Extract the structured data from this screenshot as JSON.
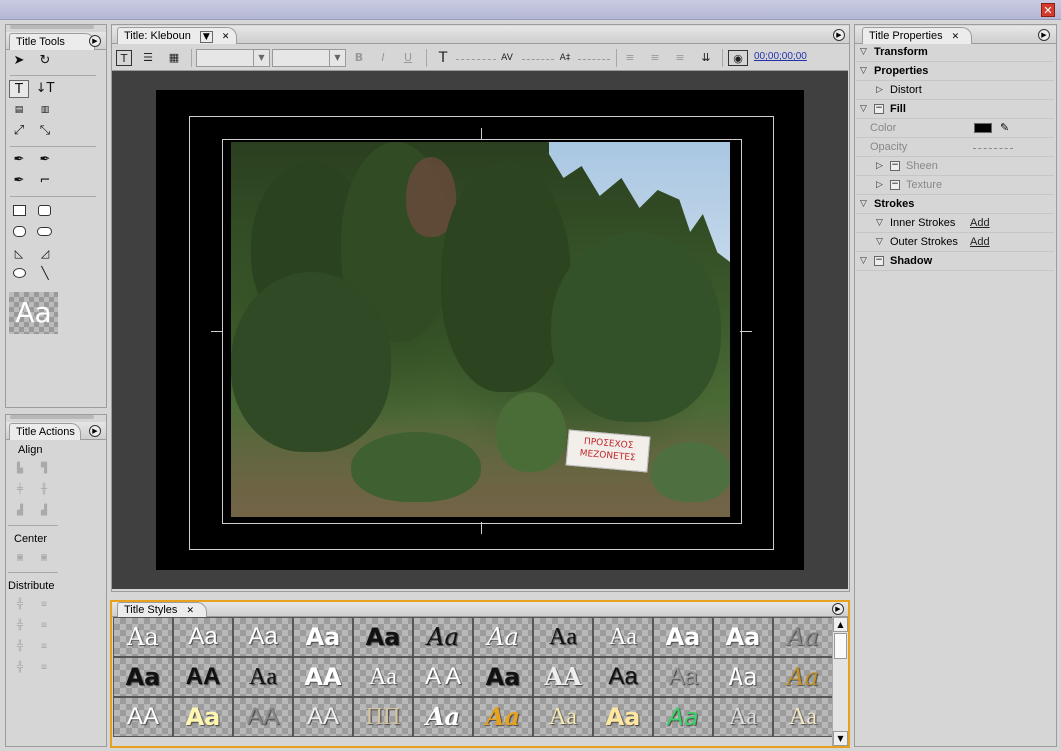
{
  "window": {
    "close_glyph": "✕"
  },
  "title_tools": {
    "tab_label": "Title Tools",
    "preview_text": "Aa"
  },
  "title_actions": {
    "tab_label": "Title Actions",
    "align_label": "Align",
    "center_label": "Center",
    "distribute_label": "Distribute"
  },
  "title_panel": {
    "tab_label": "Title: Kleboun",
    "timecode": "00;00;00;00",
    "font_family_value": "",
    "font_style_value": ""
  },
  "banner_text": [
    "ΠΡΟΣΕΧΟΣ",
    "ΜΕΖΟΝΕΤΕΣ"
  ],
  "title_styles": {
    "tab_label": "Title Styles",
    "swatches": [
      {
        "t": "Aa",
        "c": "#fff",
        "f": "\"DejaVu Serif\", serif",
        "w": "normal",
        "s": "italic-no"
      },
      {
        "t": "Aa",
        "c": "#fff",
        "f": "\"Liberation Sans\", sans-serif",
        "w": "normal"
      },
      {
        "t": "Aa",
        "c": "#fff",
        "f": "\"Liberation Sans\", sans-serif",
        "w": "normal"
      },
      {
        "t": "Aa",
        "c": "#fff",
        "f": "\"DejaVu Sans\", sans-serif",
        "w": "bold"
      },
      {
        "t": "Aa",
        "c": "#111",
        "f": "\"DejaVu Sans\", sans-serif",
        "w": "bold"
      },
      {
        "t": "Aa",
        "c": "#111",
        "f": "\"DejaVu Serif\", serif",
        "w": "normal",
        "i": true
      },
      {
        "t": "Aa",
        "c": "#fff",
        "f": "\"DejaVu Serif\", serif",
        "w": "normal",
        "i": true
      },
      {
        "t": "Aa",
        "c": "#111",
        "f": "\"Liberation Serif\", serif",
        "w": "normal"
      },
      {
        "t": "Aa",
        "c": "#fff",
        "f": "\"Liberation Serif\", serif",
        "w": "normal"
      },
      {
        "t": "Aa",
        "c": "#fff",
        "f": "\"DejaVu Sans\", sans-serif",
        "w": "bold"
      },
      {
        "t": "Aa",
        "c": "#fff",
        "f": "\"DejaVu Sans\", sans-serif",
        "w": "bold"
      },
      {
        "t": "Aa",
        "c": "#888",
        "f": "\"DejaVu Serif\", serif",
        "w": "normal",
        "i": true
      },
      {
        "t": "Aa",
        "c": "#111",
        "f": "\"DejaVu Sans\", sans-serif",
        "w": "bold"
      },
      {
        "t": "AA",
        "c": "#111",
        "f": "\"Liberation Sans\", sans-serif",
        "w": "bold"
      },
      {
        "t": "Aa",
        "c": "#111",
        "f": "\"Liberation Serif\", serif",
        "w": "normal"
      },
      {
        "t": "AA",
        "c": "#fff",
        "f": "\"DejaVu Sans\", sans-serif",
        "w": "bold"
      },
      {
        "t": "Aa",
        "c": "#fff",
        "f": "\"Liberation Serif\", serif",
        "w": "normal"
      },
      {
        "t": "A A",
        "c": "#fff",
        "f": "\"Liberation Sans\", sans-serif",
        "w": "normal"
      },
      {
        "t": "Aa",
        "c": "#111",
        "f": "\"DejaVu Sans\", sans-serif",
        "w": "bold"
      },
      {
        "t": "AA",
        "c": "#eee",
        "f": "\"DejaVu Serif\", serif",
        "w": "bold"
      },
      {
        "t": "Aa",
        "c": "#111",
        "f": "\"Liberation Sans\", sans-serif",
        "w": "normal"
      },
      {
        "t": "Aa",
        "c": "#999",
        "f": "\"Liberation Sans\", sans-serif",
        "w": "normal"
      },
      {
        "t": "Aa",
        "c": "#fff",
        "f": "\"DejaVu Sans Mono\", monospace",
        "w": "normal"
      },
      {
        "t": "Aa",
        "c": "#c0902a",
        "f": "\"DejaVu Serif\", serif",
        "w": "normal",
        "i": true
      },
      {
        "t": "AA",
        "c": "#fff",
        "f": "\"Liberation Sans\", sans-serif",
        "w": "normal"
      },
      {
        "t": "Aa",
        "c": "#fff6b0",
        "f": "\"DejaVu Sans\", sans-serif",
        "w": "bold"
      },
      {
        "t": "AA",
        "c": "#888",
        "f": "\"Liberation Sans\", sans-serif",
        "w": "normal"
      },
      {
        "t": "AA",
        "c": "#eee",
        "f": "\"Liberation Sans\", sans-serif",
        "w": "normal"
      },
      {
        "t": "ΠΠ",
        "c": "#d6c3a0",
        "f": "\"Liberation Serif\", serif",
        "w": "normal"
      },
      {
        "t": "Aa",
        "c": "#fff",
        "f": "\"DejaVu Serif\", serif",
        "w": "bold",
        "i": true
      },
      {
        "t": "Aa",
        "c": "#e8a21c",
        "f": "\"DejaVu Serif\", serif",
        "w": "bold",
        "i": true
      },
      {
        "t": "Aa",
        "c": "#f6e9b0",
        "f": "\"Liberation Serif\", serif",
        "w": "normal"
      },
      {
        "t": "Aa",
        "c": "#ffe7a0",
        "f": "\"DejaVu Sans\", sans-serif",
        "w": "bold"
      },
      {
        "t": "Aa",
        "c": "#3fd06a",
        "f": "\"DejaVu Sans\", sans-serif",
        "w": "normal",
        "i": true
      },
      {
        "t": "Aa",
        "c": "#ddd",
        "f": "\"Liberation Serif\", serif",
        "w": "normal"
      },
      {
        "t": "Aa",
        "c": "#f3e6c7",
        "f": "\"Liberation Serif\", serif",
        "w": "normal"
      }
    ]
  },
  "title_properties": {
    "tab_label": "Title Properties",
    "rows": [
      {
        "label": "Transform",
        "type": "section",
        "level": 0
      },
      {
        "label": "Properties",
        "type": "section",
        "level": 0
      },
      {
        "label": "Distort",
        "type": "collapsed",
        "level": 1
      },
      {
        "label": "Fill",
        "type": "section-check",
        "level": 0
      },
      {
        "label": "Color",
        "type": "swatch",
        "level": 1,
        "value_color": "#000000"
      },
      {
        "label": "Opacity",
        "type": "dashed",
        "level": 1
      },
      {
        "label": "Sheen",
        "type": "collapsed-check",
        "level": 1
      },
      {
        "label": "Texture",
        "type": "collapsed-check",
        "level": 1
      },
      {
        "label": "Strokes",
        "type": "section",
        "level": 0
      },
      {
        "label": "Inner Strokes",
        "type": "add",
        "level": 1,
        "link": "Add"
      },
      {
        "label": "Outer Strokes",
        "type": "add",
        "level": 1,
        "link": "Add"
      },
      {
        "label": "Shadow",
        "type": "section-check",
        "level": 0
      }
    ]
  }
}
